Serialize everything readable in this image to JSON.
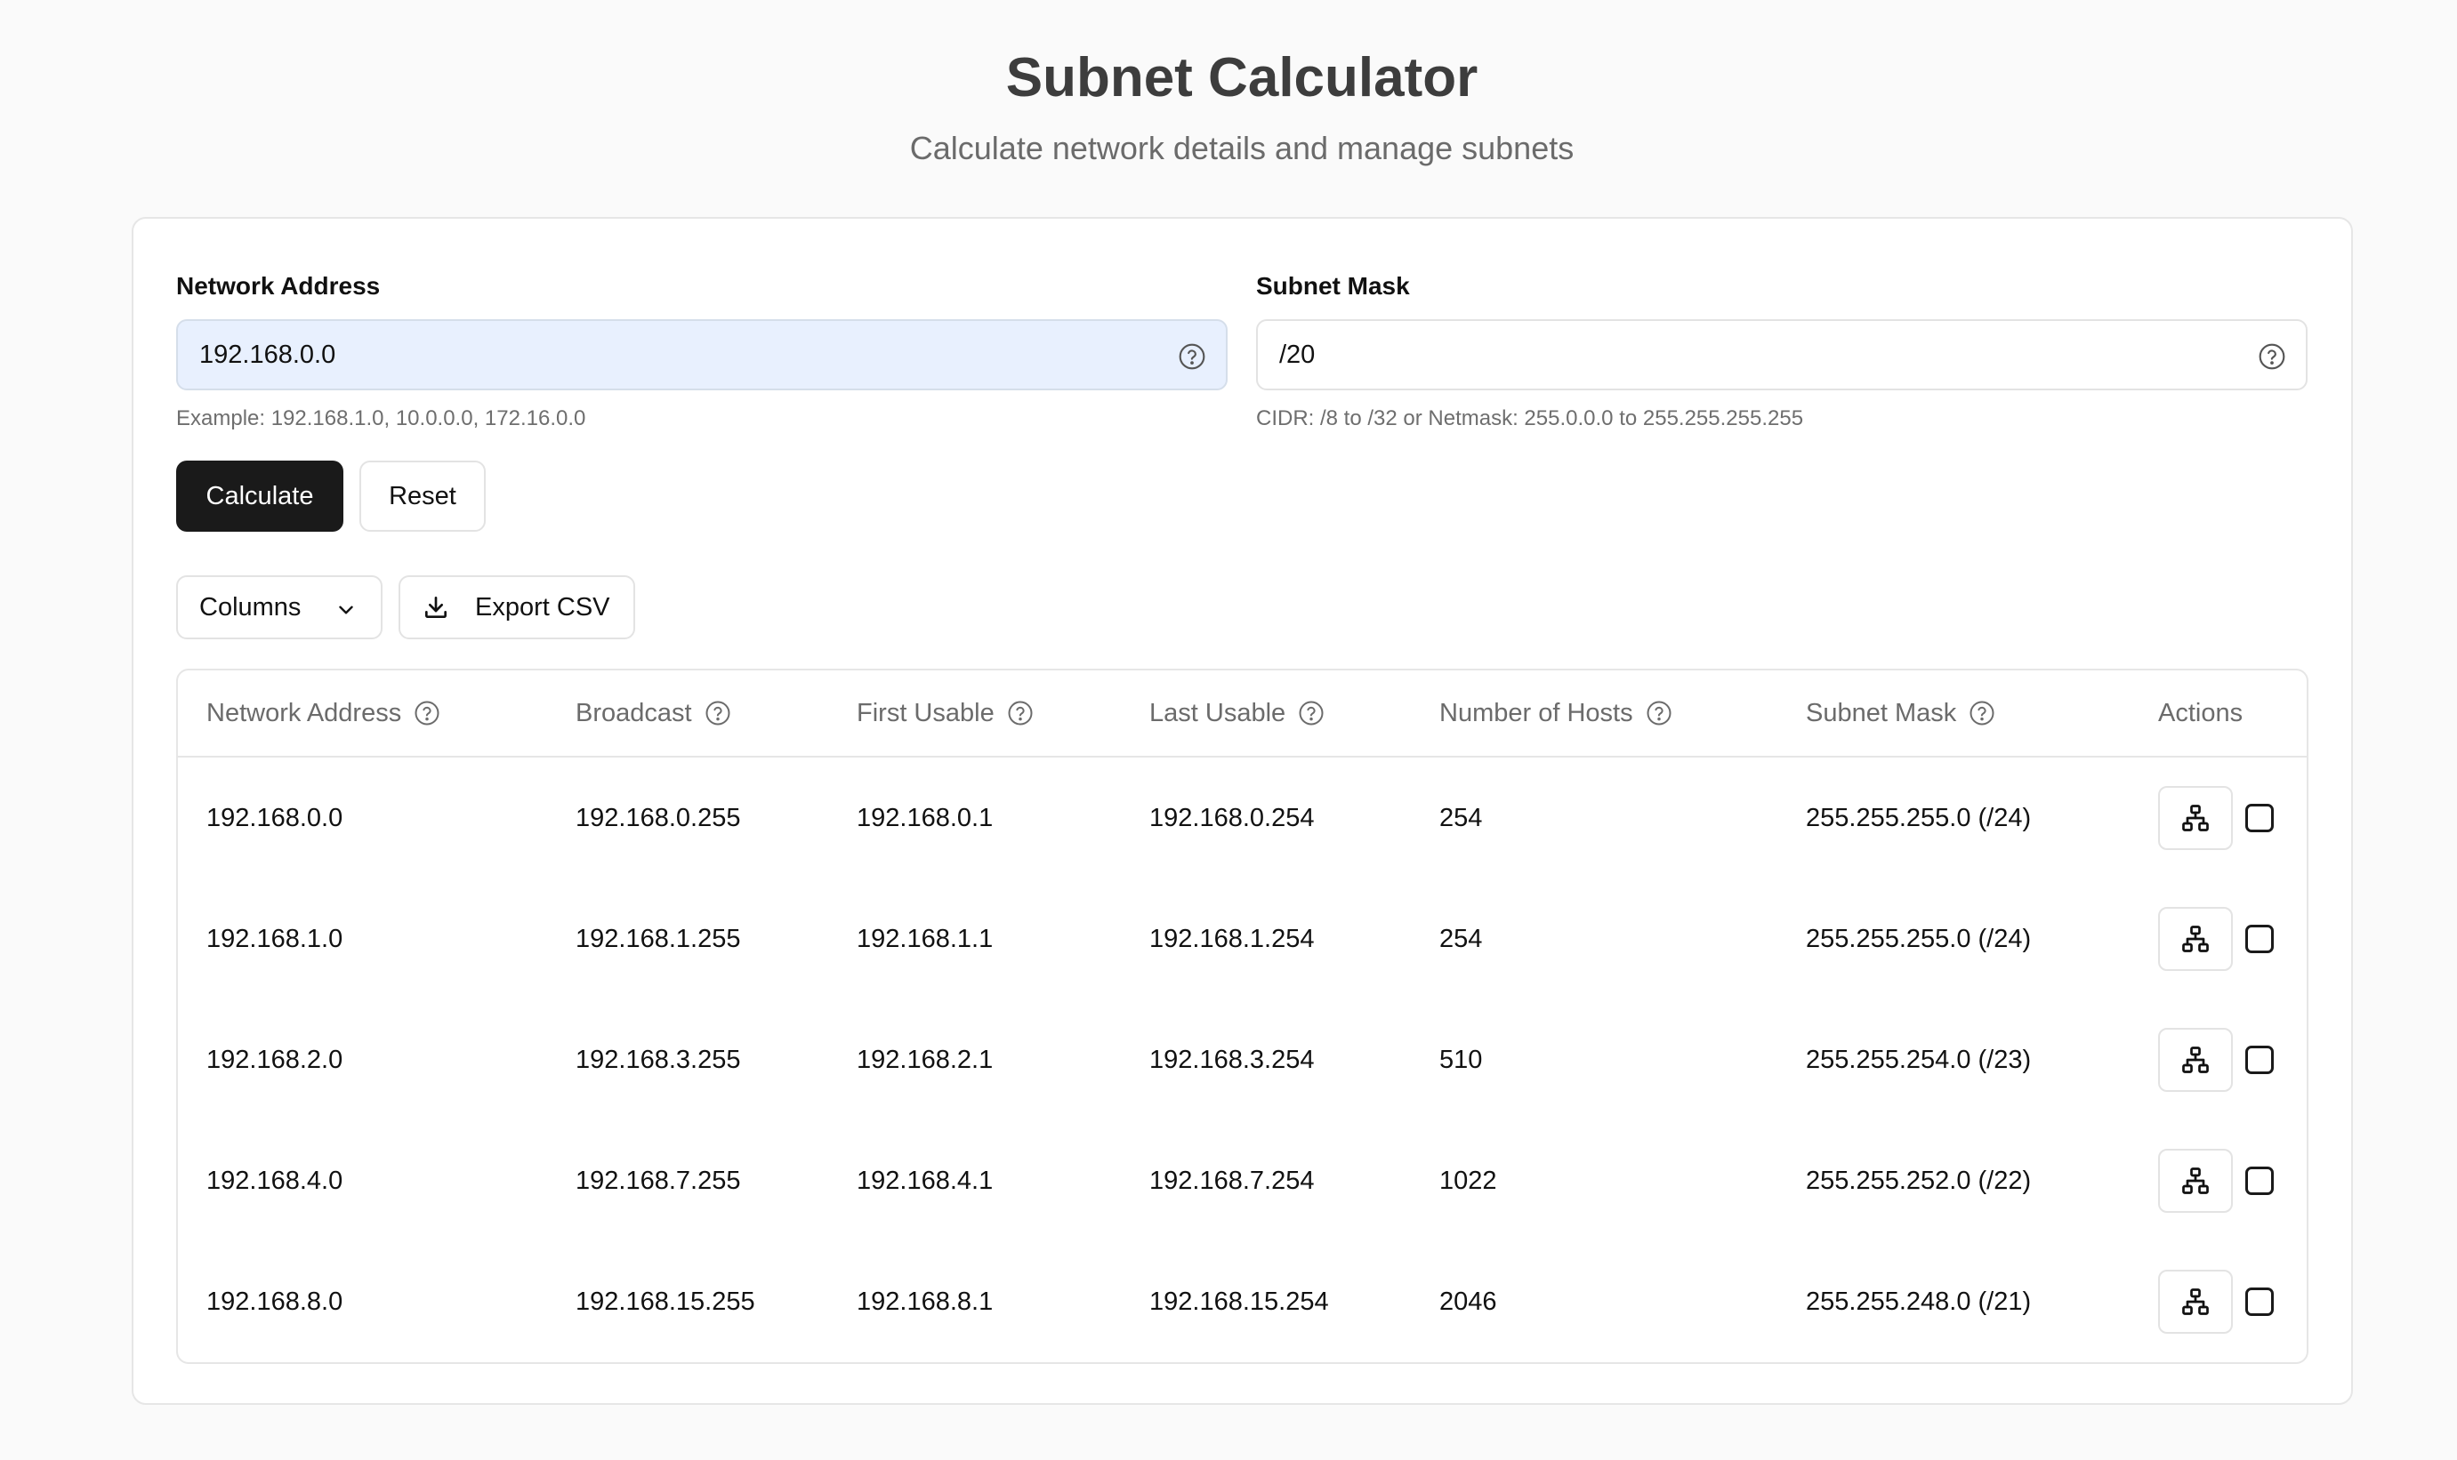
{
  "header": {
    "title": "Subnet Calculator",
    "subtitle": "Calculate network details and manage subnets"
  },
  "form": {
    "network_address": {
      "label": "Network Address",
      "value": "192.168.0.0",
      "hint": "Example: 192.168.1.0, 10.0.0.0, 172.16.0.0"
    },
    "subnet_mask": {
      "label": "Subnet Mask",
      "value": "/20",
      "hint": "CIDR: /8 to /32 or Netmask: 255.0.0.0 to 255.255.255.255"
    },
    "calculate_label": "Calculate",
    "reset_label": "Reset"
  },
  "toolbar": {
    "columns_label": "Columns",
    "export_label": "Export CSV"
  },
  "table": {
    "headers": {
      "network": "Network Address",
      "broadcast": "Broadcast",
      "first": "First Usable",
      "last": "Last Usable",
      "hosts": "Number of Hosts",
      "mask": "Subnet Mask",
      "actions": "Actions"
    },
    "rows": [
      {
        "network": "192.168.0.0",
        "broadcast": "192.168.0.255",
        "first": "192.168.0.1",
        "last": "192.168.0.254",
        "hosts": "254",
        "mask": "255.255.255.0 (/24)"
      },
      {
        "network": "192.168.1.0",
        "broadcast": "192.168.1.255",
        "first": "192.168.1.1",
        "last": "192.168.1.254",
        "hosts": "254",
        "mask": "255.255.255.0 (/24)"
      },
      {
        "network": "192.168.2.0",
        "broadcast": "192.168.3.255",
        "first": "192.168.2.1",
        "last": "192.168.3.254",
        "hosts": "510",
        "mask": "255.255.254.0 (/23)"
      },
      {
        "network": "192.168.4.0",
        "broadcast": "192.168.7.255",
        "first": "192.168.4.1",
        "last": "192.168.7.254",
        "hosts": "1022",
        "mask": "255.255.252.0 (/22)"
      },
      {
        "network": "192.168.8.0",
        "broadcast": "192.168.15.255",
        "first": "192.168.8.1",
        "last": "192.168.15.254",
        "hosts": "2046",
        "mask": "255.255.248.0 (/21)"
      }
    ]
  },
  "icons": {
    "help": "question-circle-icon",
    "columns_dropdown": "chevron-down-icon",
    "export": "download-icon",
    "row_action": "network-icon"
  },
  "colors": {
    "primary_button": "#1a1a1a",
    "focused_input": "#e8f0fe",
    "muted_text": "#6b6b6b"
  }
}
